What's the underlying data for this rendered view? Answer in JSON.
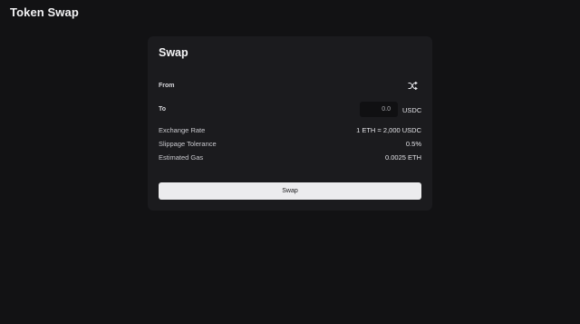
{
  "app": {
    "title": "Token Swap"
  },
  "swap_card": {
    "title": "Swap",
    "from_label": "From",
    "to_label": "To",
    "swap_direction_icon": "shuffle-icon",
    "amount_value": "0.0",
    "to_token": "USDC",
    "info": {
      "exchange_rate_label": "Exchange Rate",
      "exchange_rate_value": "1 ETH = 2,000 USDC",
      "slippage_label": "Slippage Tolerance",
      "slippage_value": "0.5%",
      "gas_label": "Estimated Gas",
      "gas_value": "0.0025 ETH"
    },
    "swap_button_label": "Swap"
  },
  "colors": {
    "background": "#121214",
    "card": "#1b1b1e",
    "input_background": "#101012",
    "button_background": "#ececee"
  }
}
